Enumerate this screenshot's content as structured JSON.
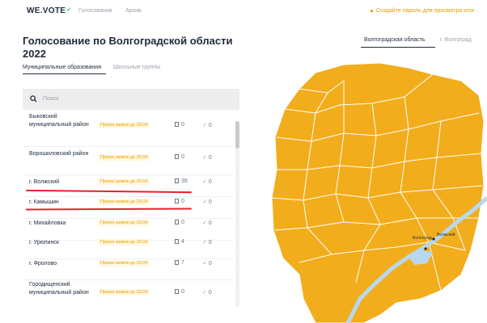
{
  "header": {
    "logo": "WE.VOTE",
    "logo_mark": "✓",
    "nav": [
      "Голосования",
      "Архив"
    ],
    "warning": "Создайте пароль для просмотра итог"
  },
  "left": {
    "title": "Голосование по Волгоградской области 2022",
    "tabs": {
      "municipal": "Муниципальные образования",
      "school": "Школьные группы"
    },
    "search": {
      "placeholder": "Поиск"
    },
    "rows": [
      {
        "name": "Быковский муниципальный район",
        "badge": "Прием заявок до 29.04",
        "docs": "0",
        "checks": "0"
      },
      {
        "name": "Ворошиловский район",
        "badge": "Прием заявок до 29.04",
        "docs": "0",
        "checks": "0"
      },
      {
        "name": "г. Волжский",
        "badge": "Прием заявок до 29.04",
        "docs": "39",
        "checks": "0"
      },
      {
        "name": "г. Камышин",
        "badge": "Прием заявок до 29.04",
        "docs": "0",
        "checks": "0"
      },
      {
        "name": "г. Михайловка",
        "badge": "Прием заявок до 29.04",
        "docs": "0",
        "checks": "0"
      },
      {
        "name": "г. Урюпинск",
        "badge": "Прием заявок до 29.04",
        "docs": "4",
        "checks": "0"
      },
      {
        "name": "г. Фролово",
        "badge": "Прием заявок до 29.04",
        "docs": "7",
        "checks": "0"
      },
      {
        "name": "Городищенский муниципальный район",
        "badge": "Прием заявок до 29.04",
        "docs": "0",
        "checks": "0"
      }
    ]
  },
  "map_panel": {
    "tabs": {
      "region": "Волгоградская область",
      "city": "г. Волгоград"
    },
    "labels": [
      "Волгоград",
      "Волжский"
    ]
  },
  "colors": {
    "map_fill": "#f2ad1c",
    "map_border": "#ffffff",
    "water": "#b8d7ee",
    "annotation": "#e8202a",
    "badge": "#e6a100"
  }
}
